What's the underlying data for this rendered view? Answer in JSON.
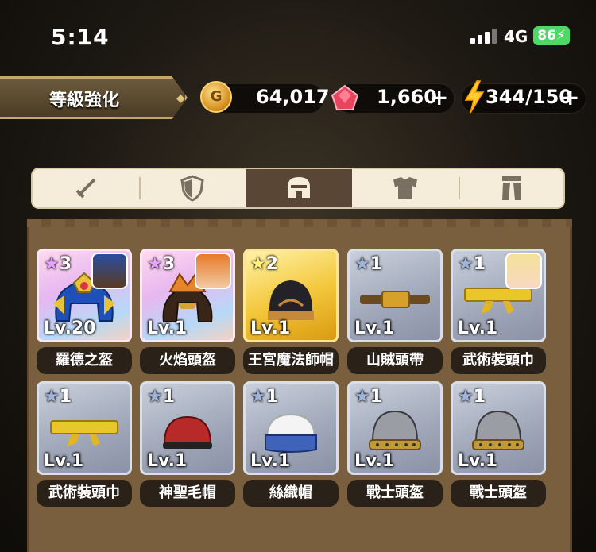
{
  "status": {
    "time": "5:14",
    "network": "4G",
    "battery": "86"
  },
  "header": {
    "title": "等級強化"
  },
  "currency": {
    "gold": "64,017",
    "gems": "1,660",
    "stamina": "344/150",
    "plus": "+"
  },
  "tabs": [
    {
      "name": "weapon",
      "icon": "sword-icon",
      "active": false
    },
    {
      "name": "shield",
      "icon": "shield-icon",
      "active": false
    },
    {
      "name": "helmet",
      "icon": "helmet-icon",
      "active": true
    },
    {
      "name": "armor",
      "icon": "armor-icon",
      "active": false
    },
    {
      "name": "legs",
      "icon": "legs-icon",
      "active": false
    }
  ],
  "items": [
    {
      "stars": "3",
      "level": "Lv.20",
      "name": "羅德之盔",
      "rarity": 3,
      "portrait": true
    },
    {
      "stars": "3",
      "level": "Lv.1",
      "name": "火焰頭盔",
      "rarity": 3,
      "portrait": true
    },
    {
      "stars": "2",
      "level": "Lv.1",
      "name": "王宮魔法師帽",
      "rarity": 2,
      "portrait": false
    },
    {
      "stars": "1",
      "level": "Lv.1",
      "name": "山賊頭帶",
      "rarity": 1,
      "portrait": false
    },
    {
      "stars": "1",
      "level": "Lv.1",
      "name": "武術裝頭巾",
      "rarity": 1,
      "portrait": true
    },
    {
      "stars": "1",
      "level": "Lv.1",
      "name": "武術裝頭巾",
      "rarity": 1,
      "portrait": false
    },
    {
      "stars": "1",
      "level": "Lv.1",
      "name": "神聖毛帽",
      "rarity": 1,
      "portrait": false
    },
    {
      "stars": "1",
      "level": "Lv.1",
      "name": "絲織帽",
      "rarity": 1,
      "portrait": false
    },
    {
      "stars": "1",
      "level": "Lv.1",
      "name": "戰士頭盔",
      "rarity": 1,
      "portrait": false
    },
    {
      "stars": "1",
      "level": "Lv.1",
      "name": "戰士頭盔",
      "rarity": 1,
      "portrait": false
    }
  ],
  "colors": {
    "active_tab": "#5a4634",
    "tabbar_bg": "#f5ecd9",
    "board": "#7a5f3f"
  }
}
